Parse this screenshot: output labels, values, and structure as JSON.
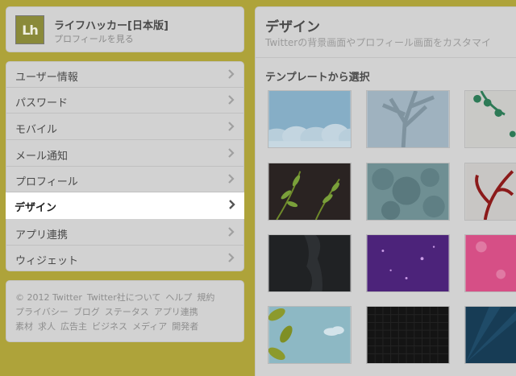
{
  "profile": {
    "avatar_text": "Lh",
    "name": "ライフハッカー[日本版]",
    "link": "プロフィールを見る"
  },
  "nav": {
    "items": [
      {
        "label": "ユーザー情報"
      },
      {
        "label": "パスワード"
      },
      {
        "label": "モバイル"
      },
      {
        "label": "メール通知"
      },
      {
        "label": "プロフィール"
      },
      {
        "label": "デザイン",
        "active": true
      },
      {
        "label": "アプリ連携"
      },
      {
        "label": "ウィジェット"
      }
    ]
  },
  "footer": {
    "lines": [
      [
        "© 2012 Twitter",
        "Twitter社について",
        "ヘルプ",
        "規約"
      ],
      [
        "プライバシー",
        "ブログ",
        "ステータス",
        "アプリ連携"
      ],
      [
        "素材",
        "求人",
        "広告主",
        "ビジネス",
        "メディア",
        "開発者"
      ]
    ]
  },
  "main": {
    "title": "デザイン",
    "description": "Twitterの背景画面やプロフィール画面をカスタマイ",
    "section_title": "テンプレートから選択",
    "templates": [
      {
        "name": "clouds"
      },
      {
        "name": "tree-silhouette"
      },
      {
        "name": "green-vines"
      },
      {
        "name": "leaf-branches-dark"
      },
      {
        "name": "teal-foliage"
      },
      {
        "name": "red-plant"
      },
      {
        "name": "dark-splatter"
      },
      {
        "name": "purple-sparkle"
      },
      {
        "name": "pink-flowers"
      },
      {
        "name": "leaves-sky"
      },
      {
        "name": "black-honeycomb"
      },
      {
        "name": "blue-rays"
      }
    ]
  },
  "colors": {
    "background": "#aea33a",
    "card": "#d2d2d2",
    "active_item": "#ffffff"
  }
}
